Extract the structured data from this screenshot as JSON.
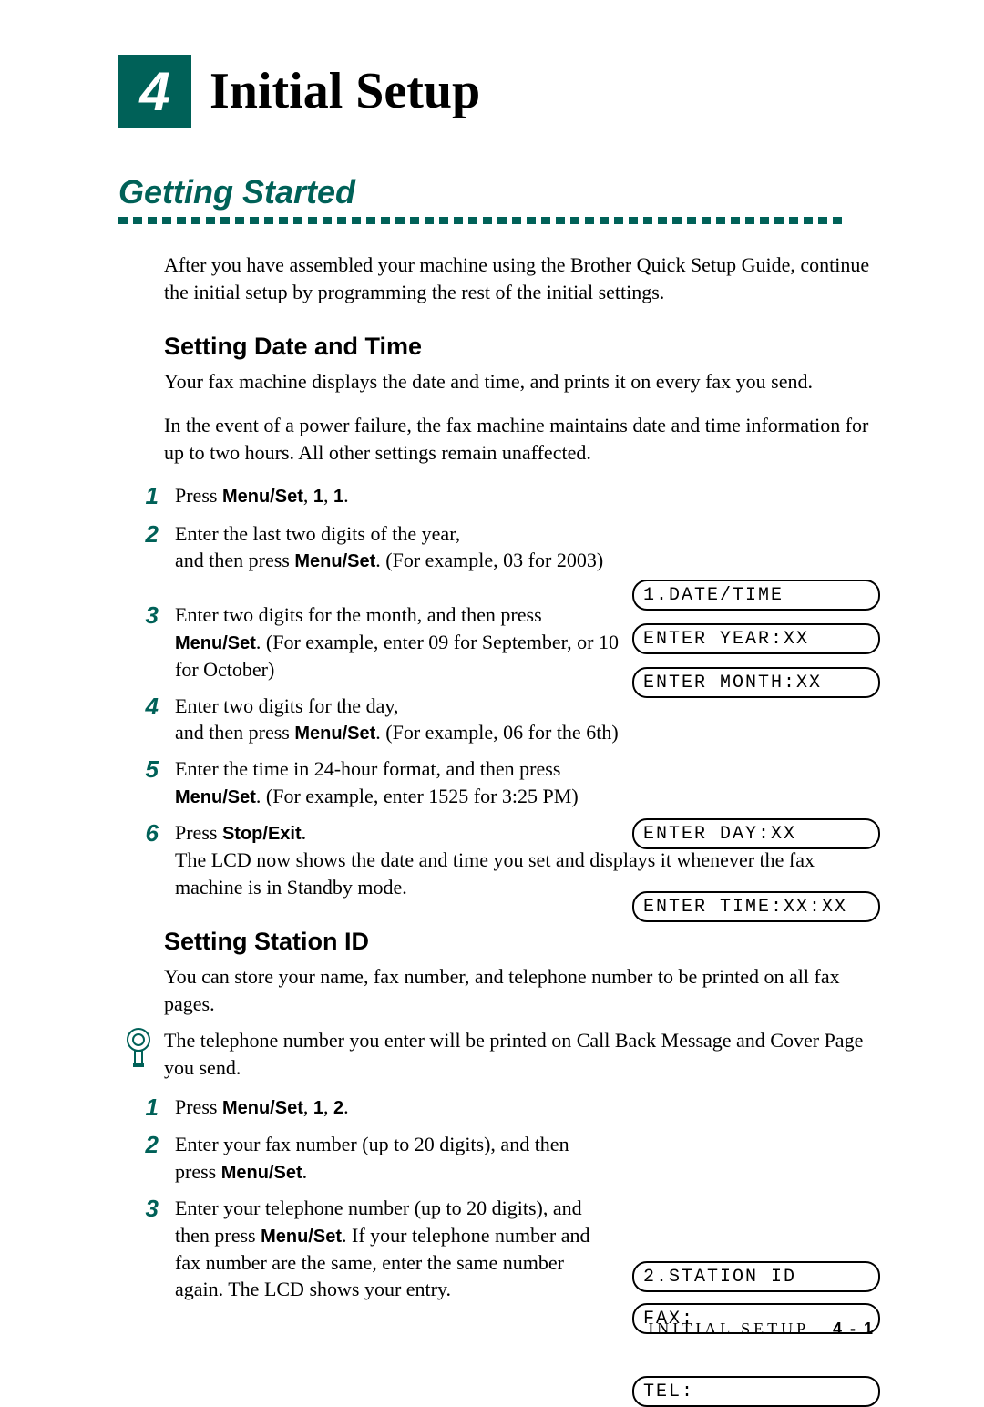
{
  "chapter": {
    "number": "4",
    "title": "Initial Setup"
  },
  "section": {
    "title": "Getting Started",
    "intro": "After you have assembled your machine using the Brother Quick Setup Guide, continue the initial setup by programming the rest of the initial settings."
  },
  "date_time": {
    "heading": "Setting Date and Time",
    "p1": "Your fax machine displays the date and time, and prints it on every fax you send.",
    "p2": "In the event of a power failure, the fax machine maintains date and time information for up to two hours. All other settings remain unaffected.",
    "steps": {
      "s1_a": "Press ",
      "s1_b": "Menu/Set",
      "s1_c": ", ",
      "s1_d": "1",
      "s1_e": ", ",
      "s1_f": "1",
      "s1_g": ".",
      "s2_a": "Enter the last two digits of the year,",
      "s2_b": "and then press ",
      "s2_c": "Menu/Set",
      "s2_d": ". (For example, 03 for 2003)",
      "s3_a": "Enter two digits for the month, and then press ",
      "s3_b": "Menu/Set",
      "s3_c": ". (For example, enter 09 for September, or 10 for October)",
      "s4_a": "Enter two digits for the day,",
      "s4_b": "and then press ",
      "s4_c": "Menu/Set",
      "s4_d": ". (For example, 06 for the 6th)",
      "s5_a": "Enter the time in 24-hour format, and then press ",
      "s5_b": "Menu/Set",
      "s5_c": ". (For example, enter 1525 for 3:25 PM)",
      "s6_a": "Press ",
      "s6_b": "Stop/Exit",
      "s6_c": ".",
      "s6_d": "The LCD now shows the date and time you set and displays it whenever the fax machine is in Standby mode."
    },
    "lcd": {
      "l1": "1.DATE/TIME",
      "l2": "ENTER YEAR:XX",
      "l3": "ENTER MONTH:XX",
      "l4": "ENTER DAY:XX",
      "l5": "ENTER TIME:XX:XX"
    }
  },
  "station_id": {
    "heading": "Setting Station ID",
    "p1": "You can store your name, fax number, and telephone number to be printed on all fax pages.",
    "note": "The telephone number you enter will be printed on Call Back Message and Cover Page you send.",
    "steps": {
      "s1_a": "Press ",
      "s1_b": "Menu/Set",
      "s1_c": ", ",
      "s1_d": "1",
      "s1_e": ", ",
      "s1_f": "2",
      "s1_g": ".",
      "s2_a": "Enter your fax number (up to 20 digits), and then press ",
      "s2_b": "Menu/Set",
      "s2_c": ".",
      "s3_a": "Enter your telephone number (up to 20 digits), and then press ",
      "s3_b": "Menu/Set",
      "s3_c": ". If your telephone number and fax number are the same, enter the same number again. The LCD shows your entry."
    },
    "lcd": {
      "l1": "2.STATION ID",
      "l2": "FAX:",
      "l3": "TEL:"
    }
  },
  "footer": {
    "label": "INITIAL SETUP",
    "page": "4 - 1"
  }
}
